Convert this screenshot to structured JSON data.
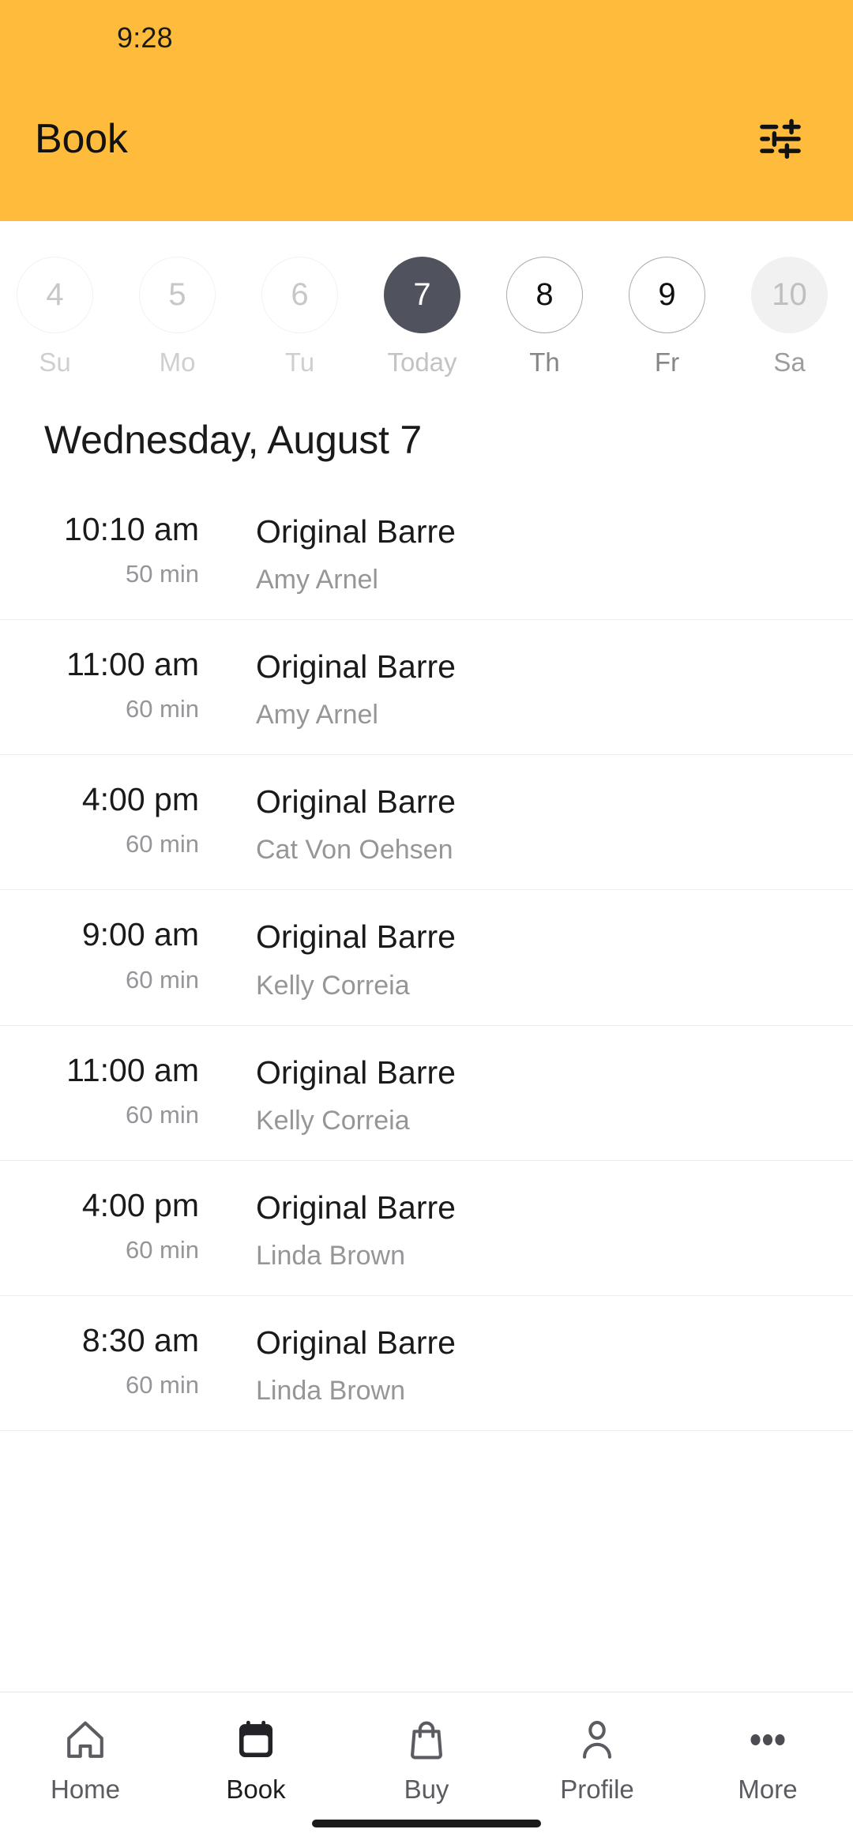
{
  "status_bar": {
    "time": "9:28"
  },
  "header": {
    "title": "Book",
    "background_color": "#FFBB3C",
    "filter_icon": "tune-filter-icon"
  },
  "week_strip": {
    "days": [
      {
        "number": "4",
        "label": "Su",
        "state": "past"
      },
      {
        "number": "5",
        "label": "Mo",
        "state": "past"
      },
      {
        "number": "6",
        "label": "Tu",
        "state": "past"
      },
      {
        "number": "7",
        "label": "Today",
        "state": "today"
      },
      {
        "number": "8",
        "label": "Th",
        "state": "open"
      },
      {
        "number": "9",
        "label": "Fr",
        "state": "open"
      },
      {
        "number": "10",
        "label": "Sa",
        "state": "muted"
      }
    ],
    "selected_color": "#50535E"
  },
  "schedule": {
    "date_heading": "Wednesday, August 7",
    "classes": [
      {
        "time": "10:10 am",
        "duration": "50 min",
        "title": "Original Barre",
        "instructor": "Amy Arnel"
      },
      {
        "time": "11:00 am",
        "duration": "60 min",
        "title": "Original Barre",
        "instructor": "Amy Arnel"
      },
      {
        "time": "4:00 pm",
        "duration": "60 min",
        "title": "Original Barre",
        "instructor": "Cat Von Oehsen"
      },
      {
        "time": "9:00 am",
        "duration": "60 min",
        "title": "Original Barre",
        "instructor": "Kelly Correia"
      },
      {
        "time": "11:00 am",
        "duration": "60 min",
        "title": "Original Barre",
        "instructor": "Kelly Correia"
      },
      {
        "time": "4:00 pm",
        "duration": "60 min",
        "title": "Original Barre",
        "instructor": "Linda Brown"
      },
      {
        "time": "8:30 am",
        "duration": "60 min",
        "title": "Original Barre",
        "instructor": "Linda Brown"
      }
    ]
  },
  "bottom_nav": {
    "active": "Book",
    "items": [
      {
        "label": "Home",
        "icon": "home-icon"
      },
      {
        "label": "Book",
        "icon": "calendar-icon"
      },
      {
        "label": "Buy",
        "icon": "shopping-bag-icon"
      },
      {
        "label": "Profile",
        "icon": "person-icon"
      },
      {
        "label": "More",
        "icon": "more-dots-icon"
      }
    ]
  }
}
